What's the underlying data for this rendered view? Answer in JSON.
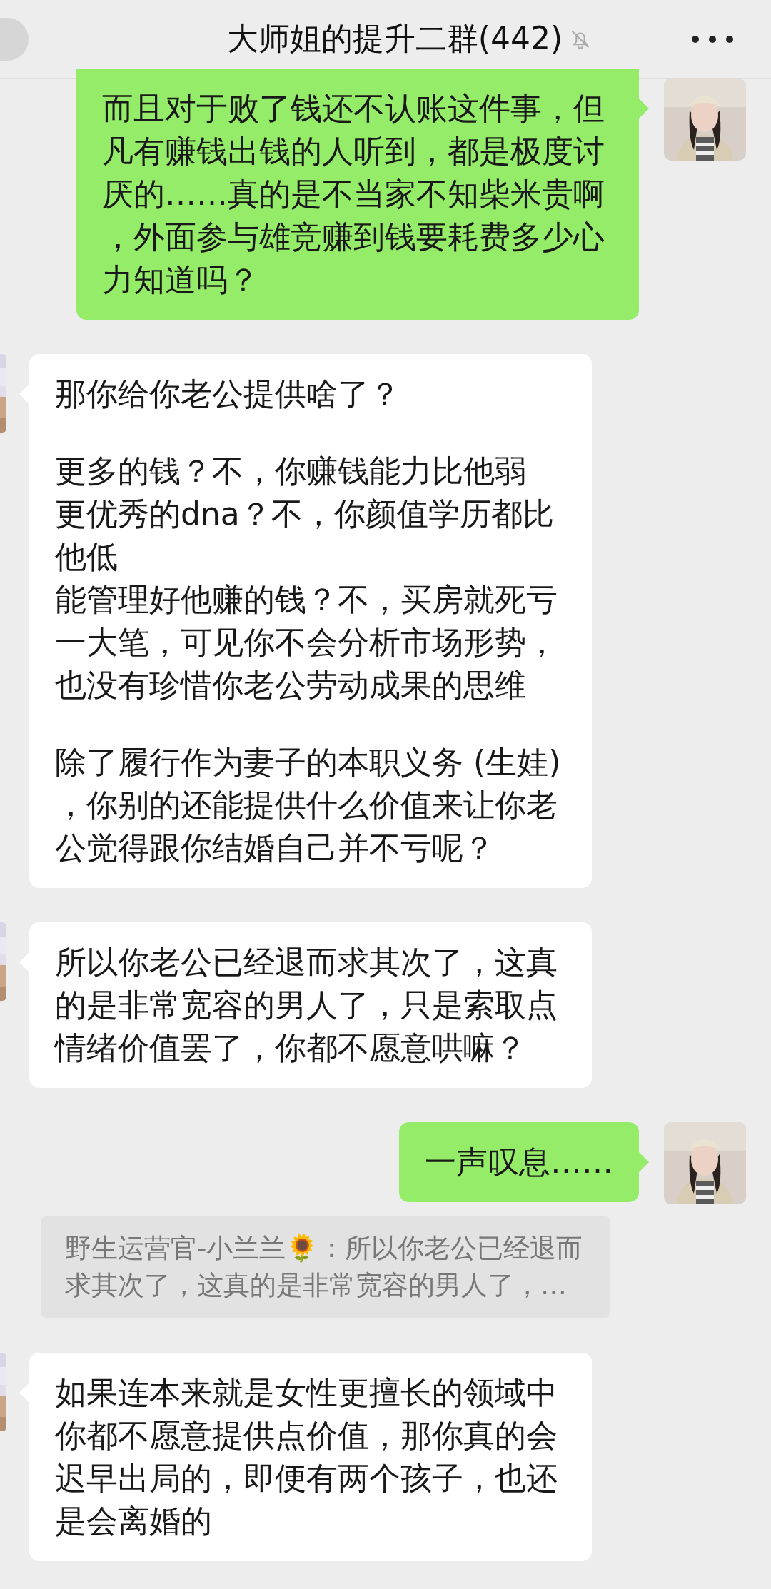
{
  "header": {
    "title": "大师姐的提升二群(442)",
    "muted": true
  },
  "messages": [
    {
      "kind": "outgoing",
      "paragraphs": [
        [
          "而且对于败了钱还不认账这件事，但凡有赚钱出钱的人听到，都是极度讨厌的……真的是不当家不知柴米贵啊，外面参与雄竞赚到钱要耗费多少心力知道吗？"
        ]
      ]
    },
    {
      "kind": "incoming",
      "paragraphs": [
        [
          "那你给你老公提供啥了？"
        ],
        [
          "更多的钱？不，你赚钱能力比他弱",
          "更优秀的dna？不，你颜值学历都比他低",
          "能管理好他赚的钱？不，买房就死亏一大笔，可见你不会分析市场形势，也没有珍惜你老公劳动成果的思维"
        ],
        [
          "除了履行作为妻子的本职义务 (生娃)，你别的还能提供什么价值来让你老公觉得跟你结婚自己并不亏呢？"
        ]
      ]
    },
    {
      "kind": "incoming",
      "paragraphs": [
        [
          "所以你老公已经退而求其次了，这真的是非常宽容的男人了，只是索取点情绪价值罢了，你都不愿意哄嘛？"
        ]
      ]
    },
    {
      "kind": "outgoing",
      "paragraphs": [
        [
          "一声叹息……"
        ]
      ]
    },
    {
      "kind": "quote",
      "text": "野生运营官-小兰兰🌻：所以你老公已经退而求其次了，这真的是非常宽容的男人了，…"
    },
    {
      "kind": "incoming",
      "paragraphs": [
        [
          "如果连本来就是女性更擅长的领域中你都不愿意提供点价值，那你真的会迟早出局的，即便有两个孩子，也还是会离婚的"
        ]
      ]
    }
  ]
}
